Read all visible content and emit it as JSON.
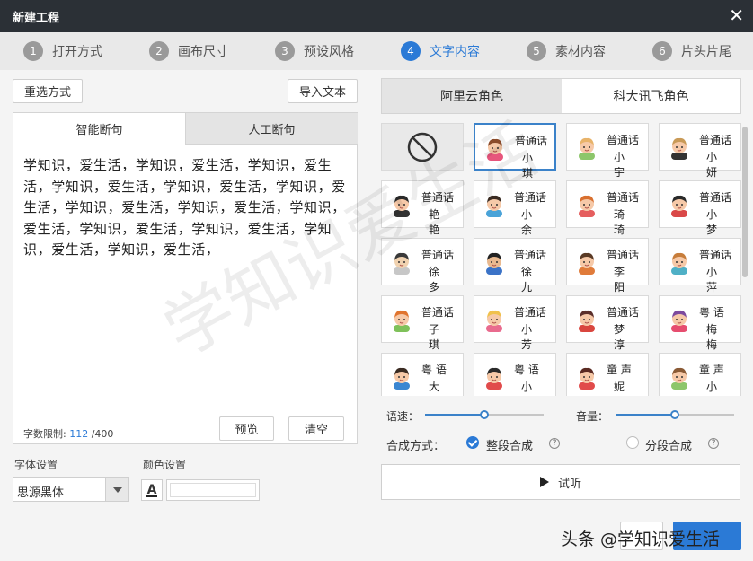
{
  "window": {
    "title": "新建工程",
    "close_glyph": "✕"
  },
  "steps": [
    {
      "num": "1",
      "label": "打开方式"
    },
    {
      "num": "2",
      "label": "画布尺寸"
    },
    {
      "num": "3",
      "label": "预设风格"
    },
    {
      "num": "4",
      "label": "文字内容",
      "active": true
    },
    {
      "num": "5",
      "label": "素材内容"
    },
    {
      "num": "6",
      "label": "片头片尾"
    }
  ],
  "left": {
    "reselect_btn": "重选方式",
    "import_btn": "导入文本",
    "tabs": [
      "智能断句",
      "人工断句"
    ],
    "text": "学知识，爱生活，学知识，爱生活，学知识，爱生活，学知识，爱生活，学知识，爱生活，学知识，爱生活，学知识，爱生活，学知识，爱生活，学知识，爱生活，学知识，爱生活，学知识，爱生活，学知识，爱生活，学知识，爱生活，",
    "limit_label": "字数限制:",
    "limit_current": "112",
    "limit_max": "/400",
    "preview_btn": "预览",
    "clear_btn": "清空",
    "font_label": "字体设置",
    "font_value": "思源黑体",
    "color_label": "颜色设置",
    "color_glyph": "A"
  },
  "right": {
    "tabs": [
      "阿里云角色",
      "科大讯飞角色"
    ],
    "voices": [
      {
        "type": "none"
      },
      {
        "lang": "普通话",
        "name": "小 琪",
        "selected": true,
        "hair": "#8a4b2a",
        "skin": "#f6c9a8",
        "shirt": "#e7557c"
      },
      {
        "lang": "普通话",
        "name": "小 宇",
        "hair": "#e8b36a",
        "skin": "#f6c9a8",
        "shirt": "#8dc66b"
      },
      {
        "lang": "普通话",
        "name": "小 妍",
        "hair": "#c99a57",
        "skin": "#f6c9a8",
        "shirt": "#333333"
      },
      {
        "lang": "普通话",
        "name": "艳 艳",
        "hair": "#2a2a2a",
        "skin": "#f6c9a8",
        "shirt": "#333333"
      },
      {
        "lang": "普通话",
        "name": "小 余",
        "hair": "#3a2b22",
        "skin": "#f6c9a8",
        "shirt": "#4aa3d8"
      },
      {
        "lang": "普通话",
        "name": "琦 琦",
        "hair": "#d9702f",
        "skin": "#f6c9a8",
        "shirt": "#e55e5e"
      },
      {
        "lang": "普通话",
        "name": "小 梦",
        "hair": "#2a2a2a",
        "skin": "#f6c9a8",
        "shirt": "#d94848"
      },
      {
        "lang": "普通话",
        "name": "徐 多",
        "hair": "#3a3a3a",
        "skin": "#f0d2b0",
        "shirt": "#c7c7c7"
      },
      {
        "lang": "普通话",
        "name": "徐 九",
        "hair": "#222222",
        "skin": "#e9b98f",
        "shirt": "#3b73c7"
      },
      {
        "lang": "普通话",
        "name": "李 阳",
        "hair": "#5a3a25",
        "skin": "#f6c9a8",
        "shirt": "#e07b3a"
      },
      {
        "lang": "普通话",
        "name": "小 萍",
        "hair": "#c77d3b",
        "skin": "#f6c9a8",
        "shirt": "#4fb0c6"
      },
      {
        "lang": "普通话",
        "name": "子 琪",
        "hair": "#e0742f",
        "skin": "#f6c9a8",
        "shirt": "#7fc15a"
      },
      {
        "lang": "普通话",
        "name": "小 芳",
        "hair": "#f0c14d",
        "skin": "#f6c9a8",
        "shirt": "#e96b8e"
      },
      {
        "lang": "普通话",
        "name": "梦 淳",
        "hair": "#5b2f2a",
        "skin": "#f6c9a8",
        "shirt": "#d9463e"
      },
      {
        "lang": "粤 语",
        "name": "梅 梅",
        "hair": "#7d4a9e",
        "skin": "#f6c9a8",
        "shirt": "#e64d6f"
      },
      {
        "lang": "粤 语",
        "name": "大 龙",
        "hair": "#3a2b22",
        "skin": "#f6c9a8",
        "shirt": "#3a86d1"
      },
      {
        "lang": "粤 语",
        "name": "小 美",
        "hair": "#2a2a2a",
        "skin": "#f6c9a8",
        "shirt": "#e14b4b"
      },
      {
        "lang": "童 声",
        "name": "妮 妮",
        "hair": "#5a2a22",
        "skin": "#f6c9a8",
        "shirt": "#e14b4b"
      },
      {
        "lang": "童 声",
        "name": "小 宝",
        "hair": "#8a5a35",
        "skin": "#f6c9a8",
        "shirt": "#8dc66b"
      }
    ],
    "speed_label": "语速：",
    "speed_value": 0.5,
    "volume_label": "音量：",
    "volume_value": 0.5,
    "synth_label": "合成方式：",
    "synth_whole": "整段合成",
    "synth_split": "分段合成",
    "help_glyph": "?",
    "listen_btn": "试听"
  },
  "footer": {
    "watermark_text": "头条 @学知识爱生活",
    "bg_watermark": "学知识爱生活"
  },
  "colors": {
    "accent": "#2b7ad6",
    "titlebar": "#2b3036"
  }
}
